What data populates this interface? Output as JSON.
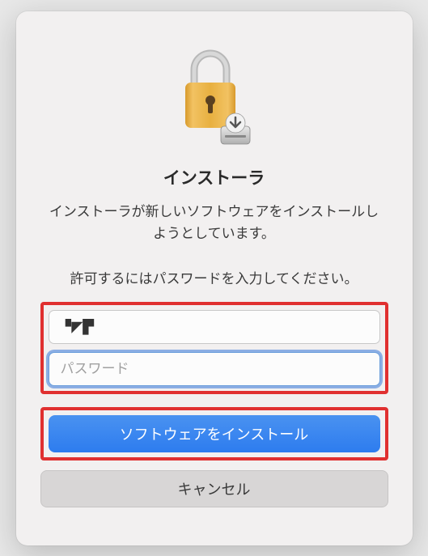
{
  "dialog": {
    "title": "インストーラ",
    "subtitle": "インストーラが新しいソフトウェアをインストールしようとしています。",
    "instruction": "許可するにはパスワードを入力してください。",
    "username_value": "▝◤▛",
    "password_placeholder": "パスワード",
    "password_value": "",
    "install_button_label": "ソフトウェアをインストール",
    "cancel_button_label": "キャンセル"
  },
  "icon": {
    "name": "lock-installer-icon"
  },
  "colors": {
    "primary": "#2d7cef",
    "highlight": "#e03030"
  }
}
